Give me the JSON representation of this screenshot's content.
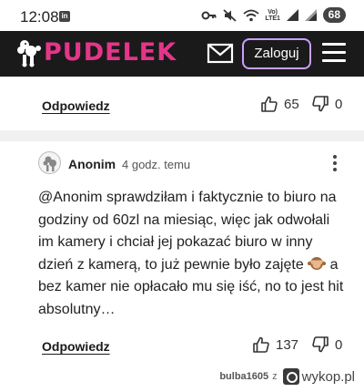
{
  "status_bar": {
    "time": "12:08",
    "app_icon_label": "in",
    "network_label": "Vo) LTE1",
    "battery": "68"
  },
  "header": {
    "logo_text": "PUDELEK",
    "login_label": "Zaloguj",
    "colors": {
      "background": "#1a1a1a",
      "logo": "#e5358a",
      "login_border": "#c9a0ff"
    }
  },
  "comments": [
    {
      "reply_label": "Odpowiedz",
      "likes": "65",
      "dislikes": "0"
    },
    {
      "author": "Anonim",
      "time": "4 godz. temu",
      "text": "@Anonim sprawdziłam i faktycznie to biuro na godziny od 60zl na miesiąc, więc jak odwołali im kamery i chciał jej pokazać biuro w inny dzień z kamerą, to już pewnie było zajęte",
      "text_after_emoji": " a bez kamer nie opłacało mu się iść, no to jest hit absolutny…",
      "emoji": "see-no-evil-monkey",
      "reply_label": "Odpowiedz",
      "likes": "137",
      "dislikes": "0"
    }
  ],
  "watermark": {
    "user": "bulba1605",
    "separator": "z",
    "site": "wykop.pl"
  }
}
